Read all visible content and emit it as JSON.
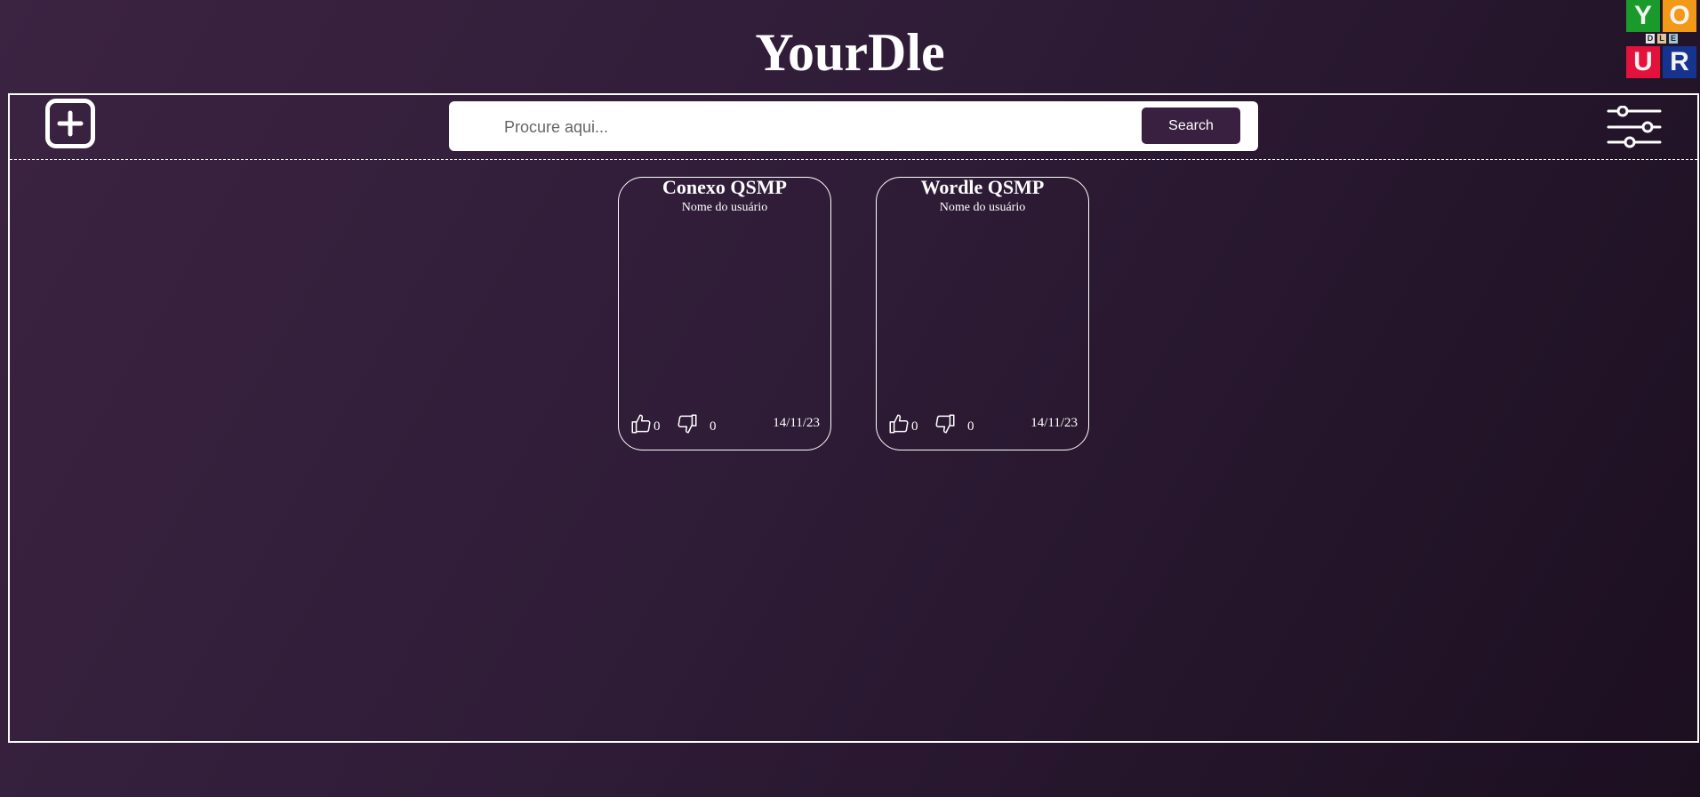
{
  "app_title": "YourDle",
  "logo": {
    "letters": [
      "Y",
      "O",
      "U",
      "R"
    ],
    "middle": [
      "D",
      "L",
      "E"
    ],
    "colors": [
      "#1a9a2a",
      "#f29a18",
      "#e3123d",
      "#15338f"
    ]
  },
  "toolbar": {
    "search_placeholder": "Procure aqui...",
    "search_value": "",
    "search_button": "Search",
    "add_icon": "plus-square-icon",
    "filter_icon": "sliders-icon"
  },
  "cards": [
    {
      "title": "Conexo QSMP",
      "user": "Nome do usuário",
      "likes": "0",
      "dislikes": "0",
      "date": "14/11/23"
    },
    {
      "title": "Wordle QSMP",
      "user": "Nome do usuário",
      "likes": "0",
      "dislikes": "0",
      "date": "14/11/23"
    }
  ]
}
